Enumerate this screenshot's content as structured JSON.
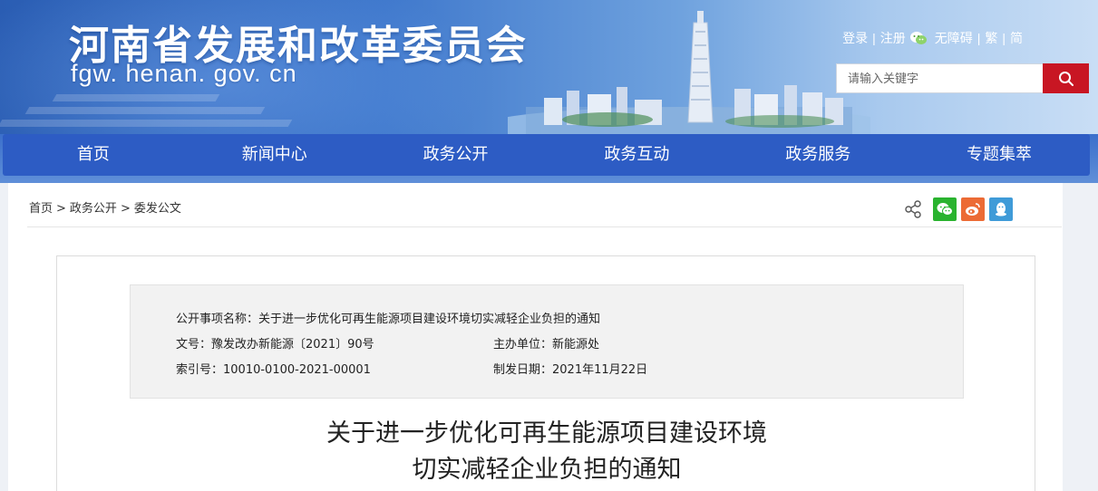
{
  "header": {
    "site_title": "河南省发展和改革委员会",
    "site_domain": "fgw. henan. gov. cn",
    "links": {
      "login": "登录",
      "register": "注册",
      "accessibility": "无障碍",
      "traditional": "繁",
      "simplified": "简"
    },
    "search": {
      "placeholder": "请输入关键字"
    },
    "icons": {
      "wechat_mini": "wechat-icon",
      "search": "search-icon"
    }
  },
  "nav": {
    "items": [
      "首页",
      "新闻中心",
      "政务公开",
      "政务互动",
      "政务服务",
      "专题集萃"
    ]
  },
  "breadcrumb": {
    "items": [
      "首页",
      "政务公开",
      "委发公文"
    ],
    "separator": ">"
  },
  "share": {
    "icons": [
      "share-icon",
      "wechat-icon",
      "weibo-icon",
      "qq-icon"
    ],
    "colors": {
      "wechat": "#2ab32f",
      "weibo": "#ec6b35",
      "qq": "#3f9bd8"
    }
  },
  "meta": {
    "item_name": "公开事项名称：关于进一步优化可再生能源项目建设环境切实减轻企业负担的通知",
    "doc_no": "文号：豫发改办新能源〔2021〕90号",
    "host_unit": "主办单位：新能源处",
    "index_no": "索引号：10010-0100-2021-00001",
    "issue_date": "制发日期：2021年11月22日"
  },
  "article": {
    "title_line1": "关于进一步优化可再生能源项目建设环境",
    "title_line2": "切实减轻企业负担的通知"
  },
  "colors": {
    "nav_bg": "#2d5cc4",
    "search_button": "#c81623"
  }
}
